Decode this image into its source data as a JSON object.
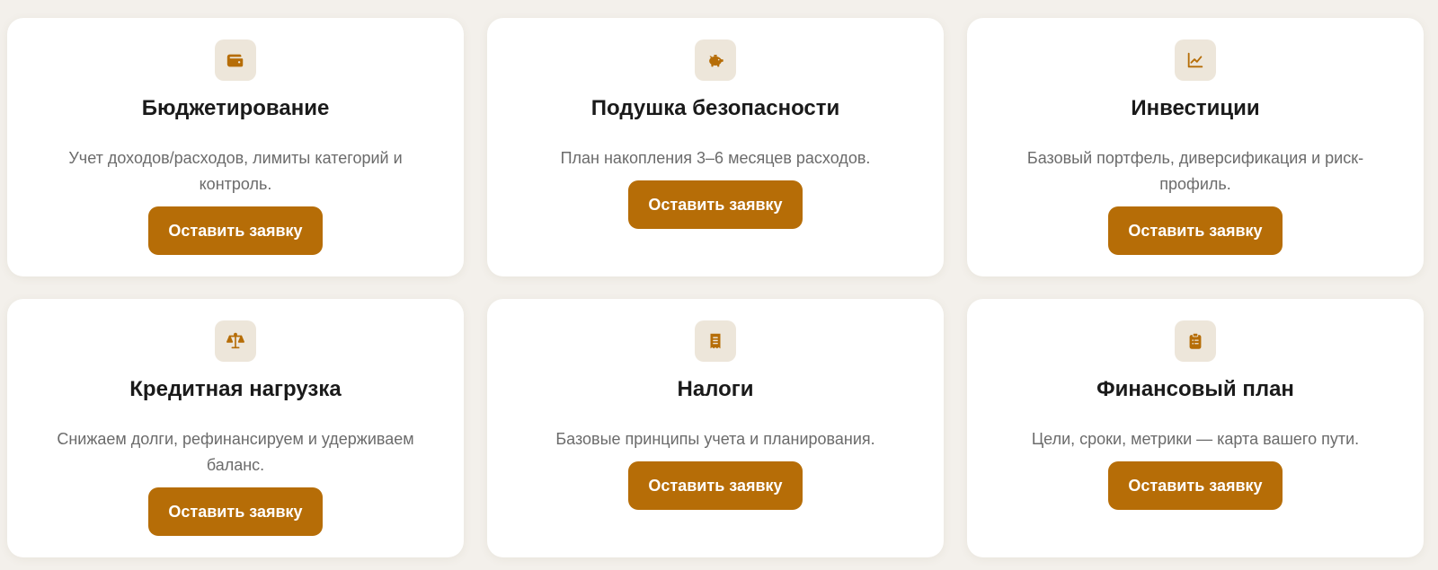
{
  "colors": {
    "background": "#f3f0eb",
    "card": "#ffffff",
    "icon_tile": "#ede6da",
    "accent": "#b66d07",
    "title": "#1a1a1a",
    "muted": "#6b6b6b"
  },
  "cards": [
    {
      "icon": "wallet-icon",
      "title": "Бюджетирование",
      "description": "Учет доходов/расходов, лимиты категорий и контроль.",
      "button_label": "Оставить заявку"
    },
    {
      "icon": "piggy-bank-icon",
      "title": "Подушка безопасности",
      "description": "План накопления 3–6 месяцев расходов.",
      "button_label": "Оставить заявку"
    },
    {
      "icon": "line-chart-icon",
      "title": "Инвестиции",
      "description": "Базовый портфель, диверсификация и риск-профиль.",
      "button_label": "Оставить заявку"
    },
    {
      "icon": "scales-icon",
      "title": "Кредитная нагрузка",
      "description": "Снижаем долги, рефинансируем и удерживаем баланс.",
      "button_label": "Оставить заявку"
    },
    {
      "icon": "receipt-icon",
      "title": "Налоги",
      "description": "Базовые принципы учета и планирования.",
      "button_label": "Оставить заявку"
    },
    {
      "icon": "clipboard-list-icon",
      "title": "Финансовый план",
      "description": "Цели, сроки, метрики — карта вашего пути.",
      "button_label": "Оставить заявку"
    }
  ]
}
